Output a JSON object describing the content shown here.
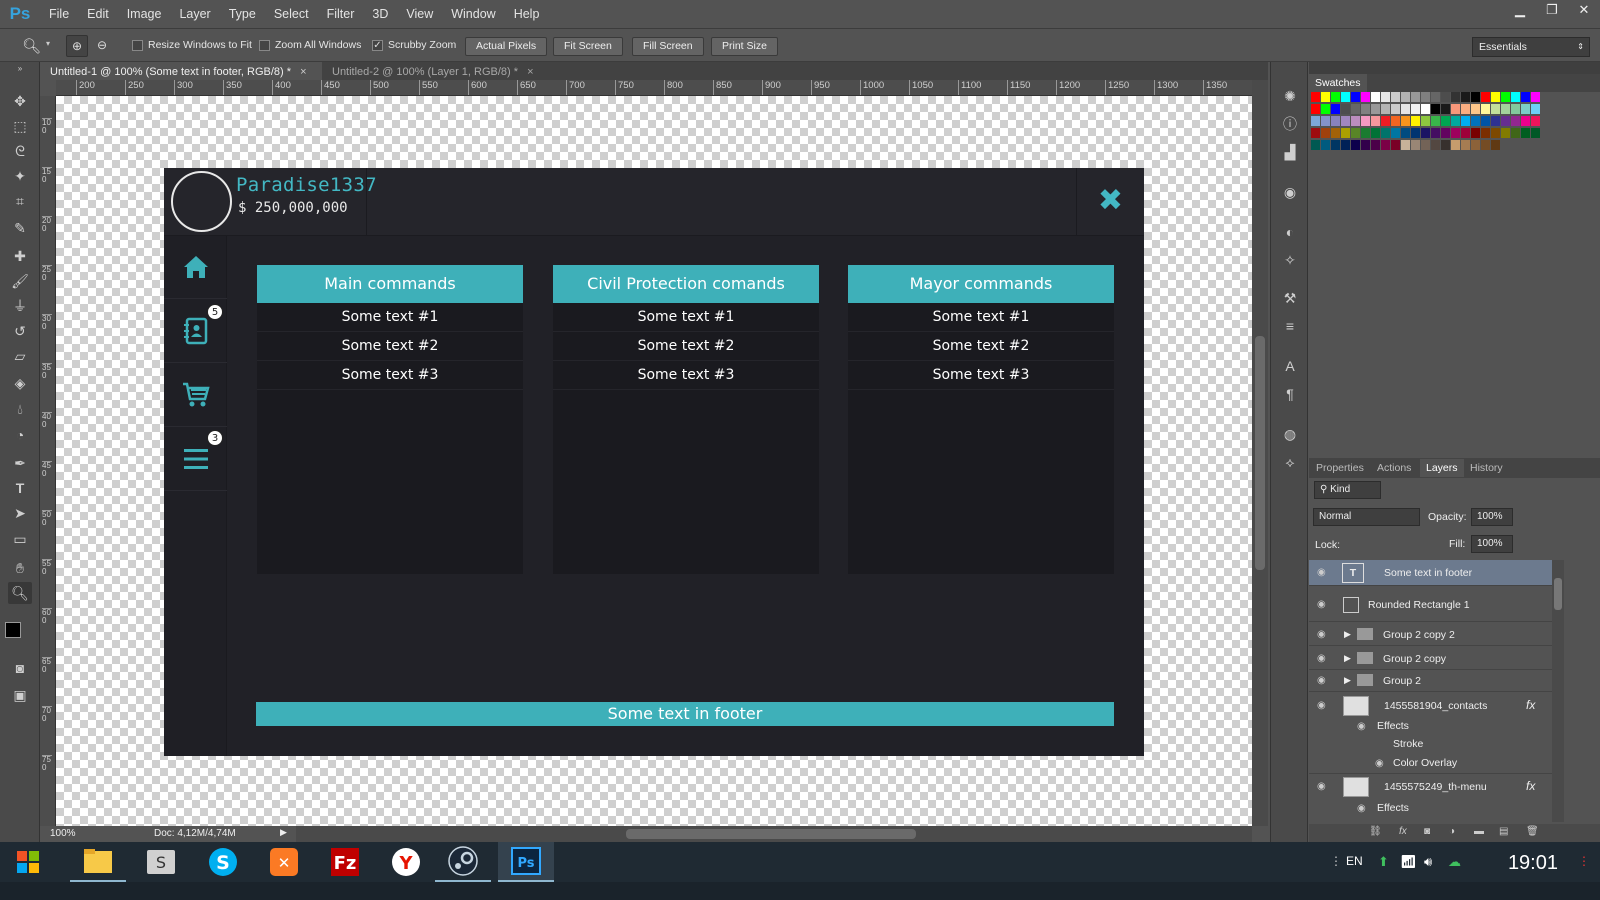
{
  "app": {
    "logo": "Ps",
    "menus": [
      "File",
      "Edit",
      "Image",
      "Layer",
      "Type",
      "Select",
      "Filter",
      "3D",
      "View",
      "Window",
      "Help"
    ],
    "window_buttons": [
      "minimize",
      "restore",
      "close"
    ]
  },
  "options": {
    "resize_windows": {
      "label": "Resize Windows to Fit",
      "checked": false
    },
    "zoom_all": {
      "label": "Zoom All Windows",
      "checked": false
    },
    "scrubby_zoom": {
      "label": "Scrubby Zoom",
      "checked": true
    },
    "buttons": [
      "Actual Pixels",
      "Fit Screen",
      "Fill Screen",
      "Print Size"
    ],
    "workspace": "Essentials"
  },
  "tabs": [
    {
      "label": "Untitled-1 @ 100% (Some text in footer, RGB/8) *",
      "close": "×"
    },
    {
      "label": "Untitled-2 @ 100% (Layer 1, RGB/8) *",
      "close": "×"
    }
  ],
  "ruler": {
    "top": [
      "200",
      "250",
      "300",
      "350",
      "400",
      "450",
      "500",
      "550",
      "600",
      "650",
      "700",
      "750",
      "800",
      "850",
      "900",
      "950",
      "1000",
      "1050",
      "1100",
      "1150",
      "1200",
      "1250",
      "1300",
      "1350"
    ],
    "left": [
      "1 0 0",
      "1 5 0",
      "2 0 0",
      "2 5 0",
      "3 0 0",
      "3 5 0",
      "4 0 0",
      "4 5 0",
      "5 0 0",
      "5 5 0",
      "6 0 0",
      "6 5 0",
      "7 0 0",
      "7 5 0"
    ]
  },
  "status": {
    "zoom": "100%",
    "doc": "Doc: 4,12M/4,74M"
  },
  "design": {
    "username": "Paradise1337",
    "money": "$ 250,000,000",
    "close": "✖",
    "badges": {
      "contacts": "5",
      "menu": "3"
    },
    "columns": [
      {
        "title": "Main commands",
        "rows": [
          "Some text #1",
          "Some text #2",
          "Some text #3"
        ]
      },
      {
        "title": "Civil Protection comands",
        "rows": [
          "Some text #1",
          "Some text #2",
          "Some text #3"
        ]
      },
      {
        "title": "Mayor commands",
        "rows": [
          "Some text #1",
          "Some text #2",
          "Some text #3"
        ]
      }
    ],
    "footer": "Some text in footer"
  },
  "swatches": {
    "title": "Swatches",
    "colors": [
      "#ff0000",
      "#ffff00",
      "#00ff00",
      "#00ffff",
      "#0000ff",
      "#ff00ff",
      "#ffffff",
      "#e6e6e6",
      "#cccccc",
      "#b3b3b3",
      "#999999",
      "#808080",
      "#666666",
      "#4d4d4d",
      "#333333",
      "#1a1a1a",
      "#000000",
      "#ff0000",
      "#ffff00",
      "#00ff00",
      "#00ffff",
      "#0000ff",
      "#ff00ff",
      "#ff0000",
      "#00ff00",
      "#0000ff",
      "#4d4d4d",
      "#666666",
      "#808080",
      "#999999",
      "#b3b3b3",
      "#cccccc",
      "#e6e6e6",
      "#f2f2f2",
      "#ffffff",
      "#000000",
      "#1a1a1a",
      "#f7977a",
      "#f9ad81",
      "#fdc68a",
      "#fff79a",
      "#c4df9b",
      "#a3d39c",
      "#82ca9d",
      "#7bcdc8",
      "#6ecff6",
      "#7ea7d8",
      "#8493ca",
      "#8882be",
      "#a187be",
      "#bc8dbf",
      "#f49ac2",
      "#f6989d",
      "#ed1c24",
      "#f26522",
      "#f7941d",
      "#fff200",
      "#8dc73f",
      "#39b54a",
      "#00a651",
      "#00a99d",
      "#00aeef",
      "#0072bc",
      "#0054a6",
      "#2e3192",
      "#662d91",
      "#92278f",
      "#ec008c",
      "#ed145b",
      "#9e0b0f",
      "#a0410d",
      "#a36209",
      "#aba000",
      "#598527",
      "#1a7b30",
      "#007236",
      "#00746b",
      "#0076a3",
      "#004b80",
      "#003471",
      "#1b1464",
      "#440e62",
      "#630460",
      "#9e005d",
      "#9e0039",
      "#790000",
      "#7b2e00",
      "#7d4900",
      "#827b00",
      "#406618",
      "#005e20",
      "#005826",
      "#005952",
      "#005b7f",
      "#003663",
      "#002157",
      "#0d004c",
      "#32004b",
      "#4b0049",
      "#7b0046",
      "#7a0026",
      "#c7b299",
      "#998675",
      "#736357",
      "#534741",
      "#37302d",
      "#c69c6d",
      "#a67c52",
      "#8c6239",
      "#754c24",
      "#603913"
    ]
  },
  "layers_panel": {
    "tabs": [
      "Properties",
      "Actions",
      "Layers",
      "History"
    ],
    "active_tab": "Layers",
    "kind": "Kind",
    "blend_mode": "Normal",
    "opacity_label": "Opacity:",
    "opacity": "100%",
    "lock_label": "Lock:",
    "fill_label": "Fill:",
    "fill": "100%",
    "layers": [
      {
        "name": "Some text in footer",
        "type": "text",
        "selected": true
      },
      {
        "name": "Rounded Rectangle 1",
        "type": "shape"
      },
      {
        "name": "Group 2 copy 2",
        "type": "group"
      },
      {
        "name": "Group 2 copy",
        "type": "group"
      },
      {
        "name": "Group 2",
        "type": "group"
      },
      {
        "name": "1455581904_contacts",
        "type": "smart",
        "fx": "fx"
      },
      {
        "name": "Effects",
        "type": "effects"
      },
      {
        "name": "Stroke",
        "type": "effect"
      },
      {
        "name": "Color Overlay",
        "type": "effect"
      },
      {
        "name": "1455575249_th-menu",
        "type": "smart",
        "fx": "fx"
      },
      {
        "name": "Effects",
        "type": "effects"
      }
    ]
  },
  "taskbar": {
    "apps": [
      "windows-start",
      "file-explorer",
      "sublime-text",
      "skype",
      "xampp",
      "filezilla",
      "yandex-browser",
      "steam",
      "photoshop"
    ],
    "lang": "EN",
    "clock": "19:01"
  }
}
